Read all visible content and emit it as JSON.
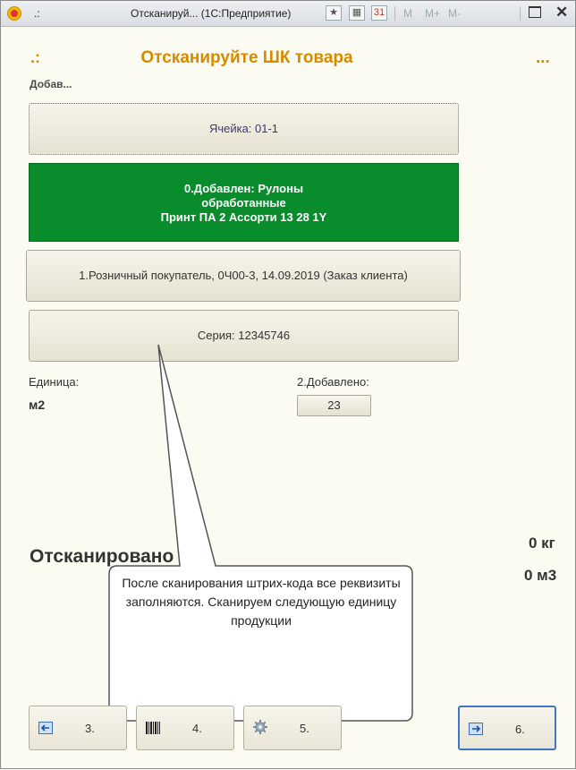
{
  "window": {
    "dots": ".:",
    "title": "Отсканируй... (1С:Предприятие)",
    "m_labels": [
      "M",
      "M+",
      "M-"
    ]
  },
  "header": {
    "dots": ".:",
    "title": "Отсканируйте ШК товара",
    "more": "..."
  },
  "added_label": "Добав...",
  "cell_button": "Ячейка: 01-1",
  "added_item": {
    "line1": "0.Добавлен:  Рулоны",
    "line2": "обработанные",
    "line3": "Принт ПА 2  Ассорти 13 28  1Y"
  },
  "order_button": "1.Розничный покупатель, 0Ч00-3, 14.09.2019 (Заказ клиента)",
  "serial_button": "Серия: 12345746",
  "unit": {
    "label": "Единица:",
    "value": "м2"
  },
  "added_count": {
    "label": "2.Добавлено:",
    "value": "23"
  },
  "scanned": {
    "title": "Отсканировано",
    "weight": "0 кг",
    "volume": "0 м3"
  },
  "callout_text": "После сканирования штрих-кода все реквизиты заполняются. Сканируем следующую единицу продукции",
  "footer": [
    {
      "label": "3.",
      "icon": "back-arrow-icon"
    },
    {
      "label": "4.",
      "icon": "barcode-icon"
    },
    {
      "label": "5.",
      "icon": "gear-icon"
    },
    {
      "label": "6.",
      "icon": "forward-arrow-icon"
    }
  ],
  "colors": {
    "accent": "#d58b00",
    "success": "#088c2c",
    "focus": "#3f76c8"
  }
}
